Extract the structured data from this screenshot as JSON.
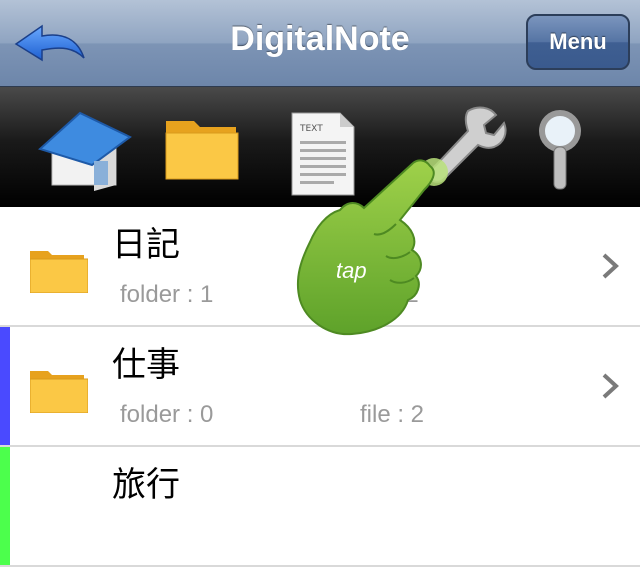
{
  "navbar": {
    "title": "DigitalNote",
    "menu_label": "Menu"
  },
  "toolbar": {
    "tools": [
      "home-icon",
      "folder-icon",
      "text-document-icon",
      "wrench-icon",
      "magnifier-icon"
    ]
  },
  "list": {
    "items": [
      {
        "name": "日記",
        "folder": "folder : 1",
        "file": ": 2",
        "stripe": "#ffffff"
      },
      {
        "name": "仕事",
        "folder": "folder : 0",
        "file": "file : 2",
        "stripe": "#4a4aff"
      },
      {
        "name": "旅行",
        "folder": "",
        "file": "",
        "stripe": "#4cff4c"
      }
    ]
  },
  "overlay": {
    "tap_label": "tap"
  },
  "colors": {
    "nav_gradient": "#8fa4c1",
    "folder_yellow": "#f7c23b",
    "hand_green": "#7ec23a"
  }
}
